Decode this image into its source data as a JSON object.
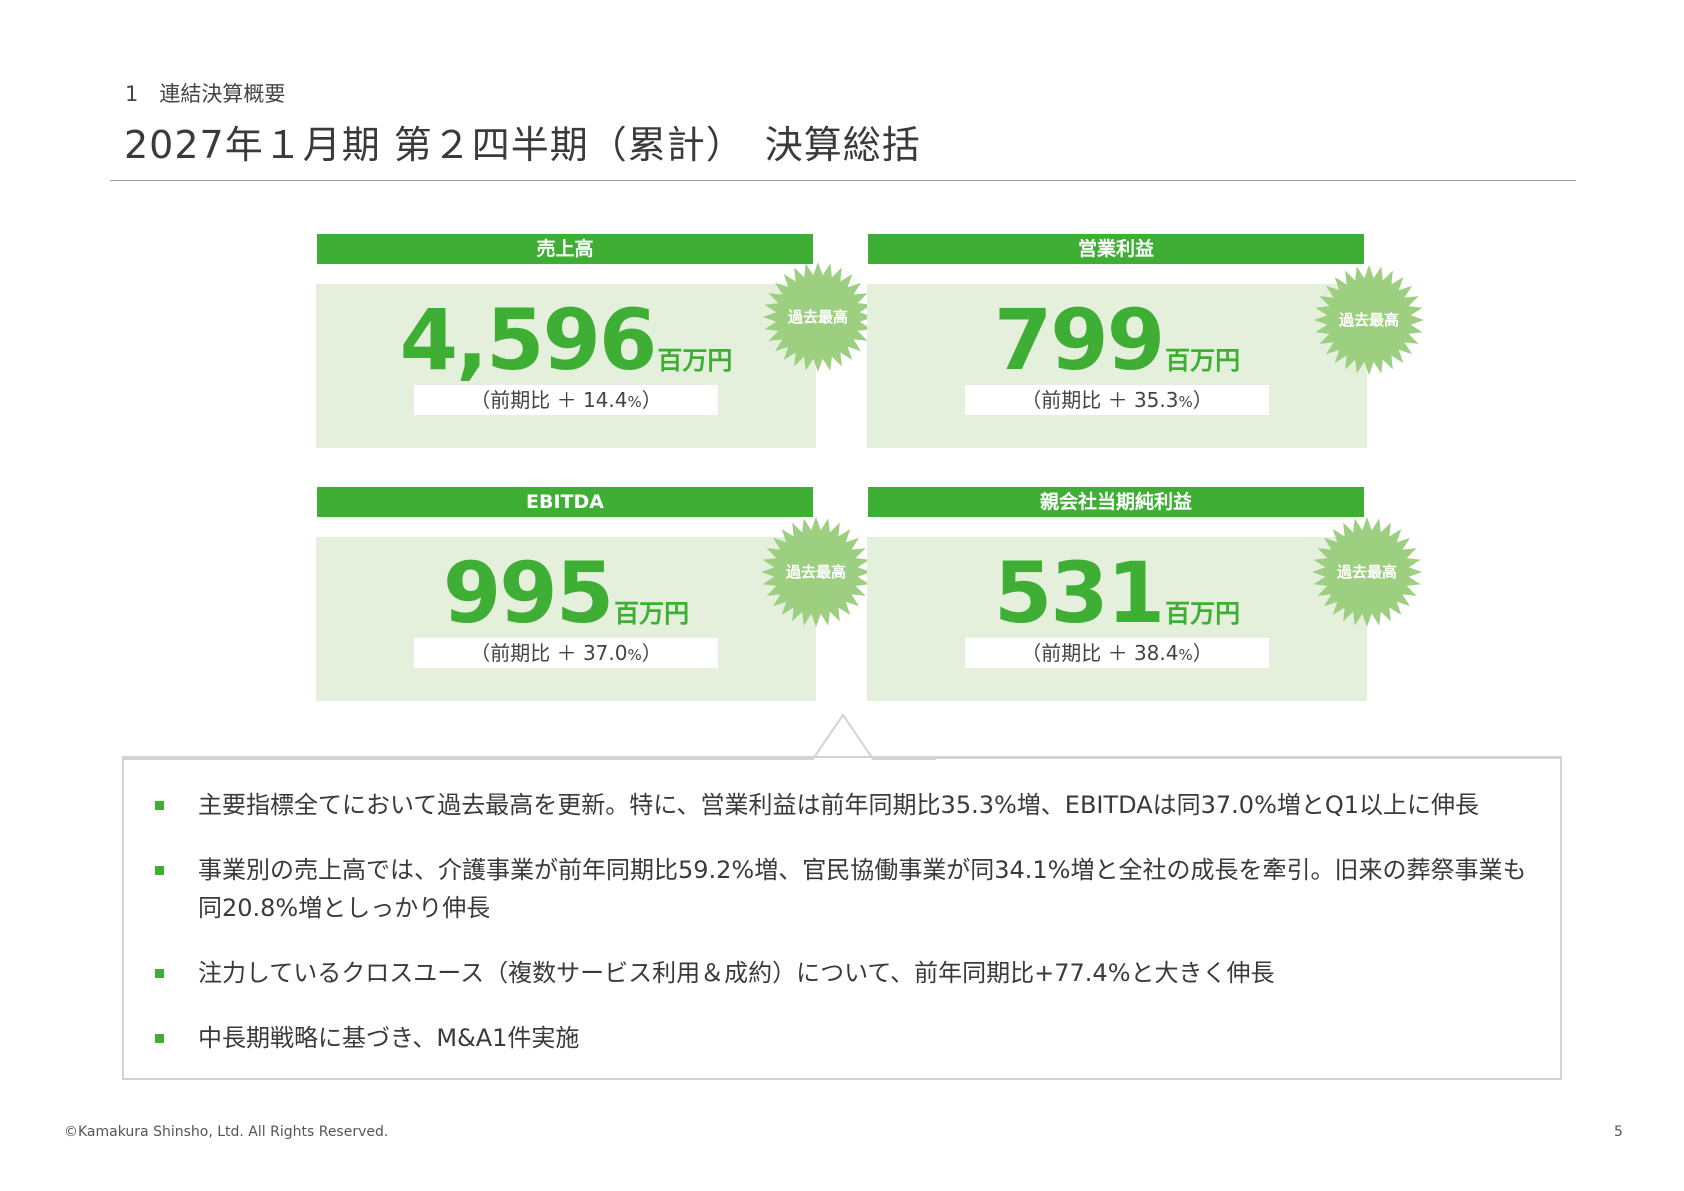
{
  "header": {
    "section_label": "1　連結決算概要",
    "title": "2027年１月期 第２四半期（累計）　決算総括"
  },
  "kpis": [
    {
      "label": "売上高",
      "value": "4,596",
      "unit": "百万円",
      "growth_prefix": "（前期比 ＋ 14.4",
      "growth_pct": "%",
      "growth_suffix": "）",
      "badge": "過去最高"
    },
    {
      "label": "営業利益",
      "value": "799",
      "unit": "百万円",
      "growth_prefix": "（前期比 ＋ 35.3",
      "growth_pct": "%",
      "growth_suffix": "）",
      "badge": "過去最高"
    },
    {
      "label": "EBITDA",
      "value": "995",
      "unit": "百万円",
      "growth_prefix": "（前期比 ＋ 37.0",
      "growth_pct": "%",
      "growth_suffix": "）",
      "badge": "過去最高"
    },
    {
      "label": "親会社当期純利益",
      "value": "531",
      "unit": "百万円",
      "growth_prefix": "（前期比 ＋ 38.4",
      "growth_pct": "%",
      "growth_suffix": "）",
      "badge": "過去最高"
    }
  ],
  "summary": {
    "items": [
      "主要指標全てにおいて過去最高を更新。特に、営業利益は前年同期比35.3%増、EBITDAは同37.0%増とQ1以上に伸長",
      "事業別の売上高では、介護事業が前年同期比59.2%増、官民協働事業が同34.1%増と全社の成長を牽引。旧来の葬祭事業も同20.8%増としっかり伸長",
      "注力しているクロスユース（複数サービス利用＆成約）について、前年同期比+77.4%と大きく伸長",
      "中長期戦略に基づき、M&A1件実施"
    ]
  },
  "footer": {
    "copyright": "©Kamakura Shinsho, Ltd. All Rights Reserved.",
    "page_number": "5"
  },
  "colors": {
    "accent_green": "#3fae35",
    "card_background": "#e5f0dc",
    "badge_green": "#9ccf80"
  }
}
